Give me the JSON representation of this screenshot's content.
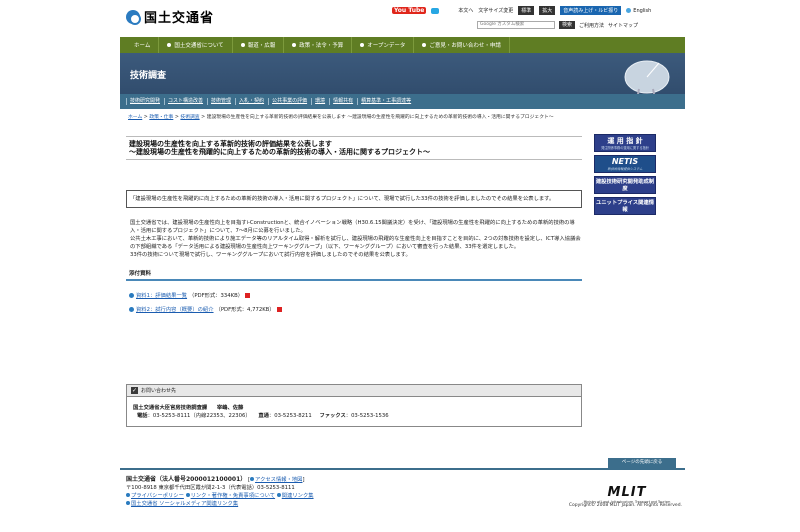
{
  "header": {
    "site_name": "国土交通省",
    "youtube": "You Tube",
    "links": [
      "本文へ",
      "文字サイズ変更"
    ],
    "size_buttons": [
      "標準",
      "拡大"
    ],
    "voice_button": "音声読み上げ・ルビ振り",
    "english": "English",
    "search_placeholder": "Google カスタム検索",
    "search_button": "検索",
    "help_links": [
      "ご利用方法",
      "サイトマップ"
    ]
  },
  "nav": [
    "ホーム",
    "国土交通省について",
    "報道・広報",
    "政策・法令・予算",
    "オープンデータ",
    "ご意見・お問い合わせ・申請"
  ],
  "banner": {
    "title": "技術調査",
    "subnav": [
      "技術研究開発",
      "コスト構造改善",
      "技術管理",
      "入札・契約",
      "公共事業の評価",
      "環境",
      "情報共有",
      "積算基準・工事調達等"
    ]
  },
  "breadcrumb": {
    "items": [
      "ホーム",
      "政策・仕事",
      "技術調査"
    ],
    "current": "建設現場の生産性を向上する革新的技術の評価結果を公表します ～建設現場の生産性を飛躍的に向上するための革新的技術の導入・活用に関するプロジェクト～"
  },
  "main": {
    "title_line1": "建設現場の生産性を向上する革新的技術の評価結果を公表します",
    "title_line2": "～建設現場の生産性を飛躍的に向上するための革新的技術の導入・活用に関するプロジェクト～",
    "summary": "「建設現場の生産性を飛躍的に向上するための革新的技術の導入・活用に関するプロジェクト」について、現場で試行した33件の技術を評価しましたのでその結果を公表します。",
    "paragraph1": "国土交通省では、建設現場の生産性向上を目指すi-Constructionと、統合イノベーション戦略（H30.6.15閣議決定）を受け、「建設現場の生産性を飛躍的に向上するための革新的技術の導入・活用に関するプロジェクト」について、7～8月に公募を行いました。",
    "paragraph2": "公共土木工事において、革新的技術により施工データ等のリアルタイム取得・解析を試行し、建設現場の飛躍的な生産性向上を目指すことを目的に、2つの対象技術を設定し、ICT導入協議会の下部組織である「データ活用による建設現場の生産性向上ワーキンググループ」（以下、ワーキンググループ）において審査を行った結果、33件を選定しました。",
    "paragraph3": "33件の技術について現場で試行し、ワーキンググループにおいて試行内容を評価しましたのでその結果を公表します。",
    "attach_heading": "添付資料",
    "attachments": [
      {
        "label": "資料1：評価結果一覧",
        "meta": "（PDF形式：334KB）"
      },
      {
        "label": "資料2：試行内容（概要）の紹介",
        "meta": "（PDF形式：4,772KB）"
      }
    ]
  },
  "side_banners": [
    {
      "title": "運 用 指 針",
      "sub": "発注関係事務の運用に関する指針"
    },
    {
      "title": "NETIS",
      "sub": "新技術情報提供システム"
    },
    {
      "title": "建設技術研究開発助成制度",
      "sub": ""
    },
    {
      "title": "ユニットプライス関連情報",
      "sub": ""
    }
  ],
  "contact": {
    "heading": "お問い合わせ先",
    "org": "国土交通省大臣官房技術調査課",
    "person": "宰嶋、佐藤",
    "tel_label": "電話",
    "tel": "：03-5253-8111（内線22353、22306）",
    "direct_label": "直通",
    "direct": "：03-5253-8211",
    "fax_label": "ファックス",
    "fax": "：03-5253-1536"
  },
  "back_to_top": "ページの先頭に戻る",
  "footer": {
    "org": "国土交通省（法人番号2000012100001）",
    "access": "アクセス情報・地図",
    "address": "〒100-8918 東京都千代田区霞が関2-1-3（代表電話）03-5253-8111",
    "links_row1": [
      "プライバシーポリシー",
      "リンク・著作権・免責事項について",
      "関連リンク集"
    ],
    "links_row2": "国土交通省 ソーシャルメディア関連リンク集",
    "mlit": "MLIT",
    "mlit_sub": "Ministry of Land, Infrastructure, Transport and Tourism",
    "copyright": "Copyright© 2008 MLIT Japan. All Rights Reserved."
  }
}
